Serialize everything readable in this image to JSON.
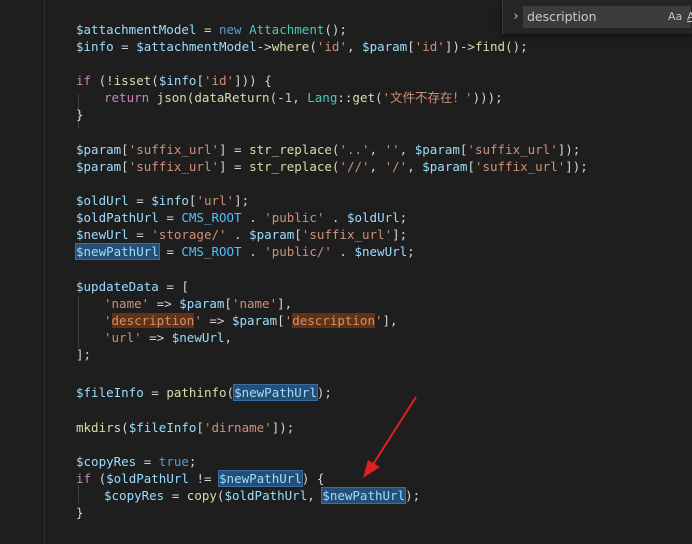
{
  "find_widget": {
    "toggle_glyph": "›",
    "query": "description",
    "match_case_label": "Aa",
    "whole_word_label": "Ab"
  },
  "annotation": {
    "arrow_color": "#e02020"
  },
  "code": {
    "l1": [
      "$attachmentModel",
      " = ",
      "new",
      " ",
      "Attachment",
      "();"
    ],
    "l2": [
      "$info",
      " = ",
      "$attachmentModel",
      "->",
      "where",
      "(",
      "'id'",
      ", ",
      "$param",
      "[",
      "'id'",
      "])->",
      "find",
      "();"
    ],
    "l3": [
      "if",
      " (!",
      "isset",
      "(",
      "$info",
      "[",
      "'id'",
      "])) {"
    ],
    "l4": [
      "return",
      " ",
      "json",
      "(",
      "dataReturn",
      "(-",
      "1",
      ", ",
      "Lang",
      "::",
      "get",
      "(",
      "'文件不存在！'",
      ")));"
    ],
    "l5": [
      "}"
    ],
    "l6": [
      "$param",
      "[",
      "'suffix_url'",
      "] = ",
      "str_replace",
      "(",
      "'..'",
      ", ",
      "''",
      ", ",
      "$param",
      "[",
      "'suffix_url'",
      "]);"
    ],
    "l7": [
      "$param",
      "[",
      "'suffix_url'",
      "] = ",
      "str_replace",
      "(",
      "'//'",
      ", ",
      "'/'",
      ", ",
      "$param",
      "[",
      "'suffix_url'",
      "]);"
    ],
    "l8": [
      "$oldUrl",
      " = ",
      "$info",
      "[",
      "'url'",
      "];"
    ],
    "l9": [
      "$oldPathUrl",
      " = ",
      "CMS_ROOT",
      " . ",
      "'public'",
      " . ",
      "$oldUrl",
      ";"
    ],
    "l10": [
      "$newUrl",
      " = ",
      "'storage/'",
      " . ",
      "$param",
      "[",
      "'suffix_url'",
      "];"
    ],
    "l11": [
      "$newPathUrl",
      " = ",
      "CMS_ROOT",
      " . ",
      "'public/'",
      " . ",
      "$newUrl",
      ";"
    ],
    "l12": [
      "$updateData",
      " = ["
    ],
    "l13": [
      "'name'",
      " => ",
      "$param",
      "[",
      "'name'",
      "],"
    ],
    "l14": [
      "'",
      "description",
      "'",
      " => ",
      "$param",
      "[",
      "'",
      "description",
      "'",
      "],"
    ],
    "l15": [
      "'url'",
      " => ",
      "$newUrl",
      ","
    ],
    "l16": [
      "];"
    ],
    "l17": [
      "$fileInfo",
      " = ",
      "pathinfo",
      "(",
      "$newPathUrl",
      ");"
    ],
    "l18": [
      "mkdirs",
      "(",
      "$fileInfo",
      "[",
      "'dirname'",
      "]);"
    ],
    "l19": [
      "$copyRes",
      " = ",
      "true",
      ";"
    ],
    "l20": [
      "if",
      " (",
      "$oldPathUrl",
      " != ",
      "$newPathUrl",
      ") {"
    ],
    "l21": [
      "$copyRes",
      " = ",
      "copy",
      "(",
      "$oldPathUrl",
      ", ",
      "$newPathUrl",
      ");"
    ],
    "l22": [
      "}"
    ]
  }
}
